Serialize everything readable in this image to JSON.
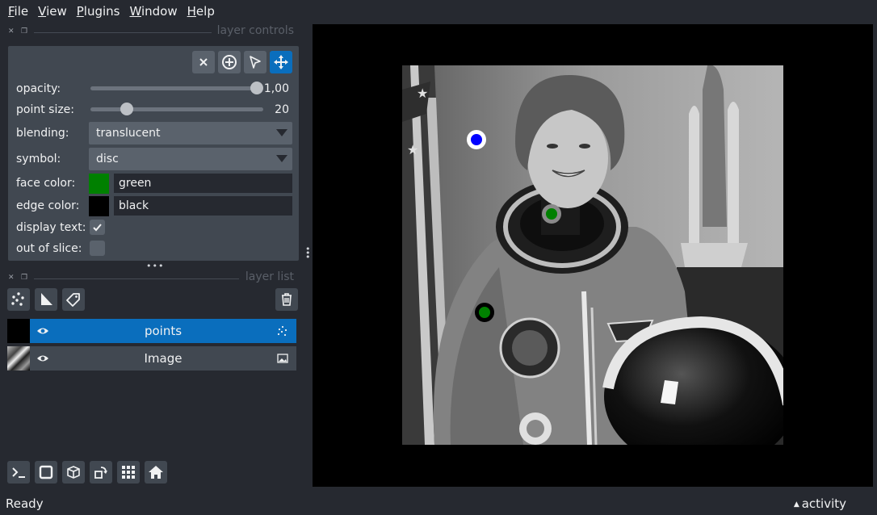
{
  "menu": [
    {
      "u": "F",
      "rest": "ile"
    },
    {
      "u": "V",
      "rest": "iew"
    },
    {
      "u": "P",
      "rest": "lugins"
    },
    {
      "u": "W",
      "rest": "indow"
    },
    {
      "u": "H",
      "rest": "elp"
    }
  ],
  "layer_controls": {
    "title": "layer controls",
    "opacity": {
      "label": "opacity:",
      "value": "1,00",
      "fraction": 1.0
    },
    "point_size": {
      "label": "point size:",
      "value": "20",
      "fraction": 0.21
    },
    "blending": {
      "label": "blending:",
      "value": "translucent"
    },
    "symbol": {
      "label": "symbol:",
      "value": "disc"
    },
    "face_color": {
      "label": "face color:",
      "value": "green",
      "swatch": "#008000"
    },
    "edge_color": {
      "label": "edge color:",
      "value": "black",
      "swatch": "#000000"
    },
    "display_text": {
      "label": "display text:",
      "checked": true
    },
    "out_of_slice": {
      "label": "out of slice:",
      "checked": false
    }
  },
  "layer_list": {
    "title": "layer list",
    "layers": [
      {
        "name": "points",
        "selected": true,
        "type_icon": "points-icon"
      },
      {
        "name": "Image",
        "selected": false,
        "type_icon": "image-icon"
      }
    ]
  },
  "canvas": {
    "points": [
      {
        "cx": 0.195,
        "cy": 0.195,
        "face": "#0000ff",
        "edge": "#ffffff"
      },
      {
        "cx": 0.391,
        "cy": 0.391,
        "face": "#008000",
        "edge": "#8a8a8a"
      },
      {
        "cx": 0.217,
        "cy": 0.651,
        "face": "#008000",
        "edge": "#000000"
      }
    ]
  },
  "status": {
    "text": "Ready",
    "activity": "activity"
  },
  "colors": {
    "accent": "#0a6ebd",
    "background": "#262930",
    "panel": "#414851"
  }
}
